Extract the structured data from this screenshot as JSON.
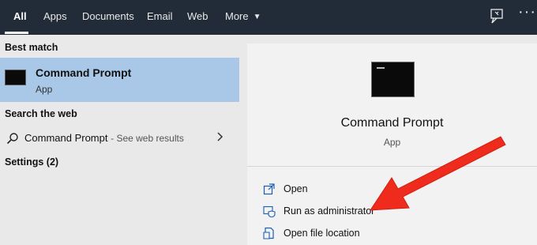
{
  "tabs": [
    {
      "label": "All",
      "active": true
    },
    {
      "label": "Apps"
    },
    {
      "label": "Documents"
    },
    {
      "label": "Email"
    },
    {
      "label": "Web"
    },
    {
      "label": "More"
    }
  ],
  "best_match": {
    "heading": "Best match",
    "title": "Command Prompt",
    "subtitle": "App"
  },
  "search_web": {
    "heading": "Search the web",
    "query": "Command Prompt",
    "suffix": "- See web results"
  },
  "settings": {
    "label": "Settings (2)"
  },
  "detail": {
    "title": "Command Prompt",
    "subtitle": "App",
    "actions": [
      {
        "label": "Open",
        "icon": "open-icon"
      },
      {
        "label": "Run as administrator",
        "icon": "shield-icon"
      },
      {
        "label": "Open file location",
        "icon": "file-location-icon"
      }
    ]
  },
  "colors": {
    "topbar_bg": "#222c38",
    "selected_bg": "#a9c8e8",
    "icon_blue": "#1a5fb4",
    "arrow_red": "#ef2b1d"
  }
}
